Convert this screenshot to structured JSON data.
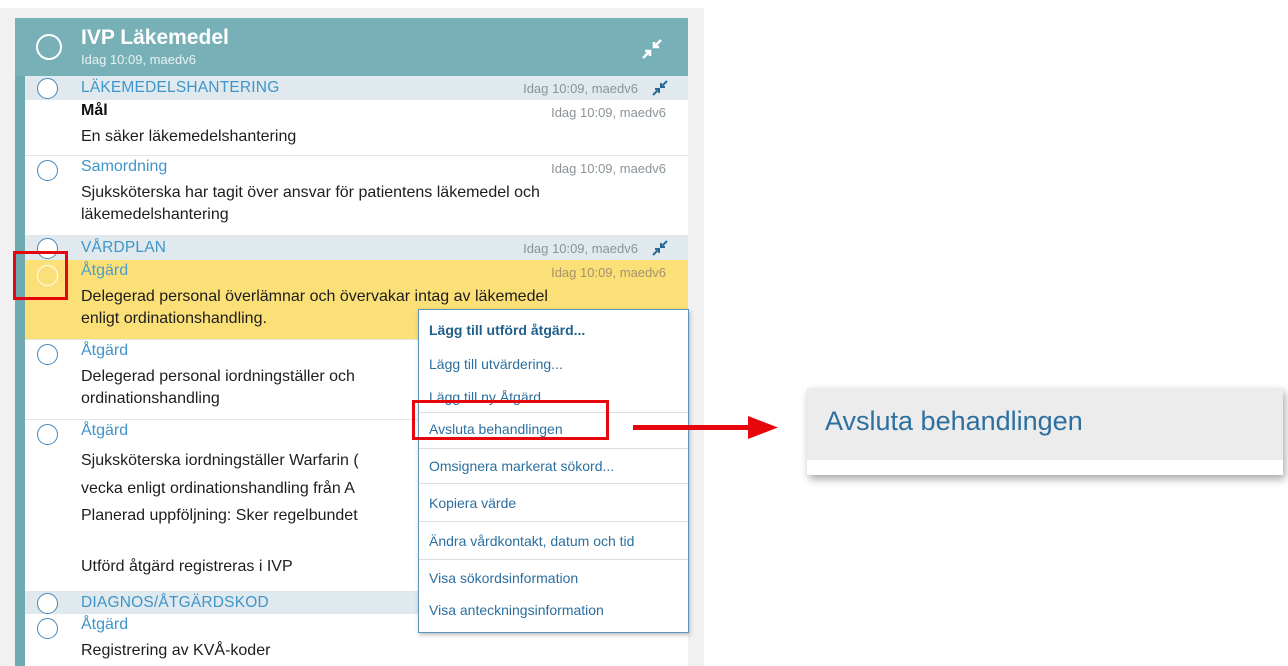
{
  "header": {
    "title": "IVP Läkemedel",
    "subtitle": "Idag 10:09, maedv6",
    "icon": "collapse-icon"
  },
  "rows": {
    "s1": {
      "label": "LÄKEMEDELSHANTERING",
      "meta": "Idag 10:09, maedv6"
    },
    "mal": {
      "title": "Mål",
      "meta": "Idag 10:09, maedv6",
      "text": "En säker läkemedelshantering"
    },
    "samordning": {
      "label": "Samordning",
      "meta": "Idag 10:09, maedv6",
      "text1": "Sjuksköterska har tagit över ansvar för patientens läkemedel och",
      "text2": "läkemedelshantering"
    },
    "s2": {
      "label": "VÅRDPLAN",
      "meta": "Idag 10:09, maedv6"
    },
    "atgard1": {
      "label": "Åtgärd",
      "meta": "Idag 10:09, maedv6",
      "text1": "Delegerad personal överlämnar och övervakar intag av läkemedel",
      "text2": "enligt ordinationshandling."
    },
    "atgard2": {
      "label": "Åtgärd",
      "text1": "Delegerad personal iordningställer och",
      "text2": "ordinationshandling"
    },
    "atgard3": {
      "label": "Åtgärd",
      "text1": "Sjuksköterska iordningställer Warfarin (",
      "text2": "vecka enligt ordinationshandling från A",
      "text3": "Planerad uppföljning: Sker regelbundet",
      "text4": "Utförd åtgärd registreras i IVP"
    },
    "s3": {
      "label": "DIAGNOS/ÅTGÄRDSKOD"
    },
    "atgard4": {
      "label": "Åtgärd",
      "text": "Registrering av KVÅ-koder"
    }
  },
  "context_menu": {
    "items": [
      "Lägg till utförd åtgärd...",
      "Lägg till utvärdering...",
      "Lägg till ny Åtgärd...",
      "Avsluta behandlingen",
      "Omsignera markerat sökord...",
      "Kopiera värde",
      "Ändra vårdkontakt, datum och tid",
      "Visa sökordsinformation",
      "Visa anteckningsinformation"
    ]
  },
  "zoom": {
    "label": "Avsluta behandlingen"
  },
  "colors": {
    "annotation_red": "#e6070d",
    "header_teal": "#78b0b8",
    "highlight": "#fbdf77",
    "link_blue": "#3f95c9"
  }
}
